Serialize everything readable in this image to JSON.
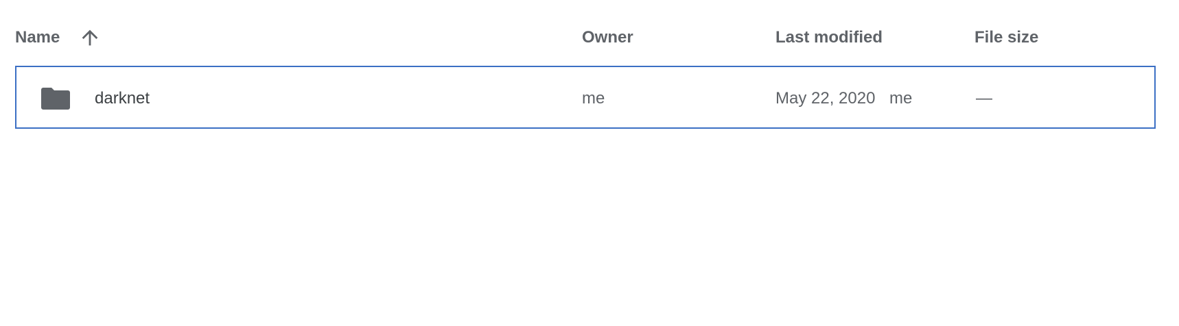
{
  "header": {
    "name_label": "Name",
    "sort_icon": "arrow-up-icon",
    "owner_label": "Owner",
    "last_modified_label": "Last modified",
    "file_size_label": "File size"
  },
  "rows": [
    {
      "icon": "folder-icon",
      "name": "darknet",
      "owner": "me",
      "modified_date": "May 22, 2020",
      "modified_by": "me",
      "file_size": "—"
    }
  ],
  "colors": {
    "selection_border": "#3b6fc4",
    "text_muted": "#5f6368",
    "text_primary": "#3c4043",
    "folder_fill": "#5f6368"
  }
}
